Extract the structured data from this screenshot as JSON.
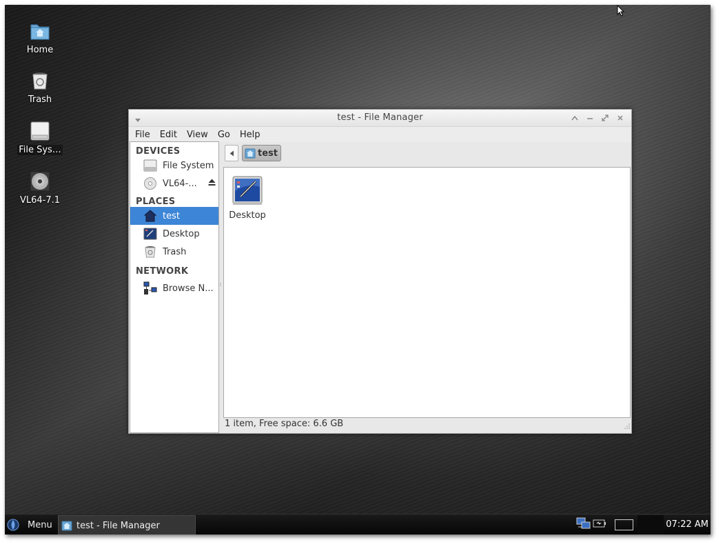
{
  "desktop": {
    "icons": [
      {
        "label": "Home",
        "icon": "home-folder-icon"
      },
      {
        "label": "Trash",
        "icon": "trash-icon"
      },
      {
        "label": "File Sys…",
        "icon": "drive-icon"
      },
      {
        "label": "VL64-7.1",
        "icon": "cdrom-icon"
      }
    ]
  },
  "window": {
    "title": "test - File Manager",
    "menu": [
      "File",
      "Edit",
      "View",
      "Go",
      "Help"
    ],
    "sidebar": {
      "sections": [
        {
          "title": "DEVICES",
          "items": [
            {
              "label": "File System",
              "icon": "harddisk-icon"
            },
            {
              "label": "VL64-...",
              "icon": "cdrom-icon",
              "eject": true
            }
          ]
        },
        {
          "title": "PLACES",
          "items": [
            {
              "label": "test",
              "icon": "home-icon",
              "selected": true
            },
            {
              "label": "Desktop",
              "icon": "desktop-folder-icon"
            },
            {
              "label": "Trash",
              "icon": "trash-icon"
            }
          ]
        },
        {
          "title": "NETWORK",
          "items": [
            {
              "label": "Browse N...",
              "icon": "network-icon"
            }
          ]
        }
      ]
    },
    "pathbar": {
      "current": "test"
    },
    "files": [
      {
        "name": "Desktop",
        "icon": "desktop-folder-icon"
      }
    ],
    "status": "1 item, Free space: 6.6 GB"
  },
  "taskbar": {
    "menu_label": "Menu",
    "task_label": "test - File Manager",
    "clock": "07:22 AM"
  },
  "colors": {
    "selection": "#3d85d6",
    "taskbar": "#0d0d0d"
  }
}
